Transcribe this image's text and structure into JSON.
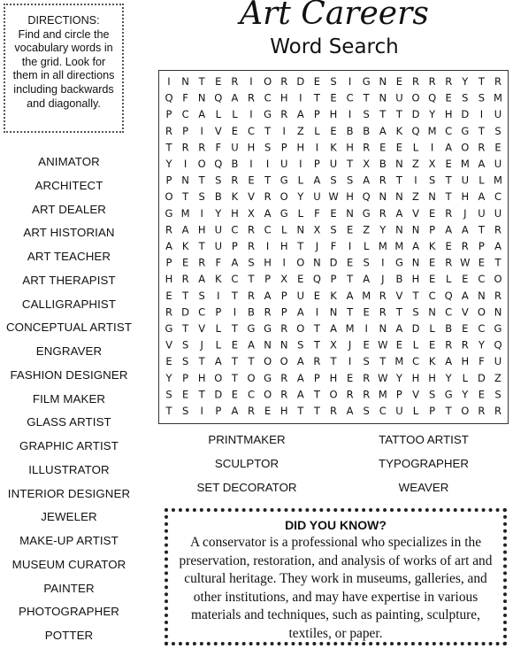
{
  "directions": {
    "heading": "DIRECTIONS:",
    "text": "Find and circle the vocabulary words in the grid.  Look for them in all directions including backwards and diagonally."
  },
  "title": {
    "main": "Art Careers",
    "sub": "Word Search"
  },
  "word_list": [
    "ANIMATOR",
    "ARCHITECT",
    "ART DEALER",
    "ART HISTORIAN",
    "ART TEACHER",
    "ART THERAPIST",
    "CALLIGRAPHIST",
    "CONCEPTUAL ARTIST",
    "ENGRAVER",
    "FASHION DESIGNER",
    "FILM MAKER",
    "GLASS ARTIST",
    "GRAPHIC ARTIST",
    "ILLUSTRATOR",
    "INTERIOR DESIGNER",
    "JEWELER",
    "MAKE-UP ARTIST",
    "MUSEUM CURATOR",
    "PAINTER",
    "PHOTOGRAPHER",
    "POTTER"
  ],
  "extra_words_left": [
    "PRINTMAKER",
    "SCULPTOR",
    "SET DECORATOR"
  ],
  "extra_words_right": [
    "TATTOO ARTIST",
    "TYPOGRAPHER",
    "WEAVER"
  ],
  "grid": [
    "INTERIORDESIGNERRRYTR",
    "QFNQARCHITECTNUOQESSM",
    "PCALLIGRAPHISTTDYHDIU",
    "RPIVECTIZLEBBAKQMCGTS",
    "TRRFUHSPHIKHREELIAORE",
    "YIOQBIIUIPUTXBNZXEMAU",
    "PNTSRETGLASSARTISTULM",
    "OTSBKVROYUWHQNNZNTHAC",
    "GMIYHXAGLFENGRAVERJUU",
    "RAHUCRCLNXSEZYNNPAATR",
    "AKTUPRIHTJFILMMAKERPA",
    "PERFASHIONDESIGNERWET",
    "HRAKCTPXEQPTAJBHELECO",
    "ETSITRAPUEKAMRVTCQANR",
    "RDCPIBRPAINTERTSNCVON",
    "GTVLTGGROTAMINADLBECG",
    "VSJLEANNSTXJEWELERRYQ",
    "ESTATTOOARTISTMCKAHFU",
    "YPHOTOGRAPHERWYHHYLDZ",
    "SETDECORATORRMPVSGYES",
    "TSIPAREHTTRASCULPTORR"
  ],
  "did_you_know": {
    "title": "DID YOU KNOW?",
    "text": "A conservator is a professional who specializes in the preservation, restoration, and analysis of works of art and cultural heritage. They work in museums, galleries, and other institutions, and may have expertise in various materials and techniques, such as painting, sculpture, textiles, or paper."
  }
}
